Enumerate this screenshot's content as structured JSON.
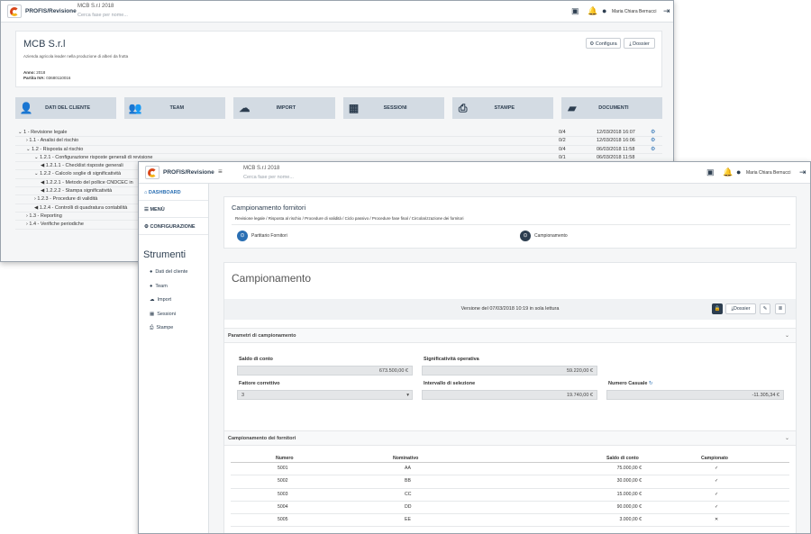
{
  "back": {
    "brand": "PROFIS/Revisione",
    "client_title": "MCB S.r.l 2018",
    "search_placeholder": "Cerca fase per nome...",
    "user": "Maria Chiara Bernucci",
    "company": "MCB S.r.l",
    "description": "Azienda agricola leader nella produzione di alberi da frutta",
    "anno_label": "Anno:",
    "anno_value": "2018",
    "piva_label": "Partita IVA:",
    "piva_value": "03680110016",
    "configura": "Configura",
    "dossier": "Dossier",
    "tiles": [
      {
        "label": "DATI DEL CLIENTE",
        "icon": "user-icon"
      },
      {
        "label": "TEAM",
        "icon": "team-icon"
      },
      {
        "label": "IMPORT",
        "icon": "cloud-upload-icon"
      },
      {
        "label": "SESSIONI",
        "icon": "calendar-icon"
      },
      {
        "label": "STAMPE",
        "icon": "printer-icon"
      },
      {
        "label": "DOCUMENTI",
        "icon": "folder-icon"
      }
    ],
    "tree": [
      {
        "text": "1 - Revisione legale",
        "count": "0/4",
        "date": "12/03/2018 16:07"
      },
      {
        "text": "1.1 - Analisi del rischio",
        "count": "0/2",
        "date": "12/03/2018 16:06"
      },
      {
        "text": "1.2 - Risposta al rischio",
        "count": "0/4",
        "date": "06/03/2018 11:58"
      },
      {
        "text": "1.2.1 - Configurazione risposte generali di revisione",
        "count": "0/1",
        "date": "06/03/2018 11:58"
      },
      {
        "text": "1.2.1.1 - Checklist risposte generali",
        "count": "",
        "date": ""
      },
      {
        "text": "1.2.2 - Calcolo soglie di significatività",
        "count": "",
        "date": ""
      },
      {
        "text": "1.2.2.1 - Metodo del pollice CNDCEC in",
        "count": "",
        "date": ""
      },
      {
        "text": "1.2.2.2 - Stampa significatività",
        "count": "",
        "date": ""
      },
      {
        "text": "1.2.3 - Procedure di validità",
        "count": "",
        "date": ""
      },
      {
        "text": "1.2.4 - Controlli di quadratura contabilità",
        "count": "",
        "date": ""
      },
      {
        "text": "1.3 - Reporting",
        "count": "",
        "date": ""
      },
      {
        "text": "1.4 - Verifiche periodiche",
        "count": "",
        "date": ""
      }
    ]
  },
  "front": {
    "brand": "PROFIS/Revisione",
    "client_title": "MCB S.r.l 2018",
    "search_placeholder": "Cerca fase per nome...",
    "user": "Maria Chiara Bernucci",
    "nav": [
      "DASHBOARD",
      "MENÙ",
      "CONFIGURAZIONE"
    ],
    "strumenti_title": "Strumenti",
    "tools": [
      "Dati del cliente",
      "Team",
      "Import",
      "Sessioni",
      "Stampe"
    ],
    "section_title": "Campionamento fornitori",
    "breadcrumb": [
      "Revisione legale",
      "Risposta al rischio",
      "Procedure di validità",
      "Ciclo passivo",
      "Procedure fase final",
      "Circolarizzazione dei fornitori"
    ],
    "steps": [
      {
        "label": "Partitario Fornitori"
      },
      {
        "label": "Campionamento"
      }
    ],
    "page_title": "Campionamento",
    "version_text": "Versione del 07/03/2018 10:19 in sola lettura",
    "dossier": "Dossier",
    "params_title": "Parametri di campionamento",
    "saldo_label": "Saldo di conto",
    "saldo_value": "673.500,00 €",
    "sig_label": "Significatività operativa",
    "sig_value": "59.220,00 €",
    "fattore_label": "Fattore correttivo",
    "fattore_value": "3",
    "intervallo_label": "Intervallo di selezione",
    "intervallo_value": "19.740,00 €",
    "numcas_label": "Numero Casuale",
    "numcas_value": "-11.305,34 €",
    "table_title": "Campionamento dei fornitori",
    "columns": [
      "Numero",
      "Nominativo",
      "Saldo di conto",
      "Campionato"
    ],
    "rows": [
      [
        "5001",
        "AA",
        "75.000,00 €",
        "✓"
      ],
      [
        "5002",
        "BB",
        "30.000,00 €",
        "✓"
      ],
      [
        "5003",
        "CC",
        "15.000,00 €",
        "✓"
      ],
      [
        "5004",
        "DD",
        "90.000,00 €",
        "✓"
      ],
      [
        "5005",
        "EE",
        "3.000,00 €",
        "✕"
      ]
    ]
  }
}
